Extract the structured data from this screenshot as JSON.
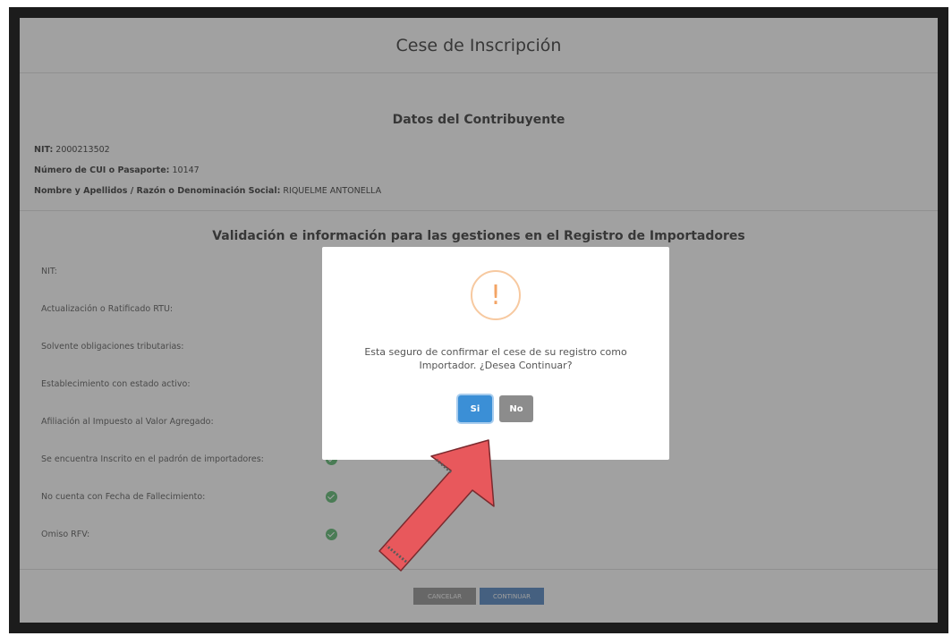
{
  "page": {
    "title": "Cese de Inscripción"
  },
  "taxpayer": {
    "section_title": "Datos del Contribuyente",
    "nit_label": "NIT:",
    "nit_value": "2000213502",
    "cui_label": "Número de CUI o Pasaporte:",
    "cui_value": "10147",
    "name_label": "Nombre y Apellidos / Razón o Denominación Social:",
    "name_value": "RIQUELME ANTONELLA"
  },
  "validation": {
    "title": "Validación e información para las gestiones en el Registro de Importadores",
    "rows": [
      {
        "label": "NIT:"
      },
      {
        "label": "Actualización o Ratificado RTU:"
      },
      {
        "label": "Solvente obligaciones tributarias:"
      },
      {
        "label": "Establecimiento con estado activo:"
      },
      {
        "label": "Afiliación al Impuesto al Valor Agregado:"
      },
      {
        "label": "Se encuentra Inscrito en el padrón de importadores:"
      },
      {
        "label": "No cuenta con Fecha de Fallecimiento:"
      },
      {
        "label": "Omiso RFV:"
      }
    ]
  },
  "footer": {
    "cancel_label": "CANCELAR",
    "continue_label": "CONTINUAR"
  },
  "modal": {
    "icon": "!",
    "message": "Esta seguro de confirmar el cese de su registro como Importador. ¿Desea Continuar?",
    "yes_label": "Si",
    "no_label": "No"
  },
  "colors": {
    "primary": "#3b8fd6",
    "success": "#56b16a",
    "warning": "#f3a465",
    "arrow": "#e8585c"
  }
}
